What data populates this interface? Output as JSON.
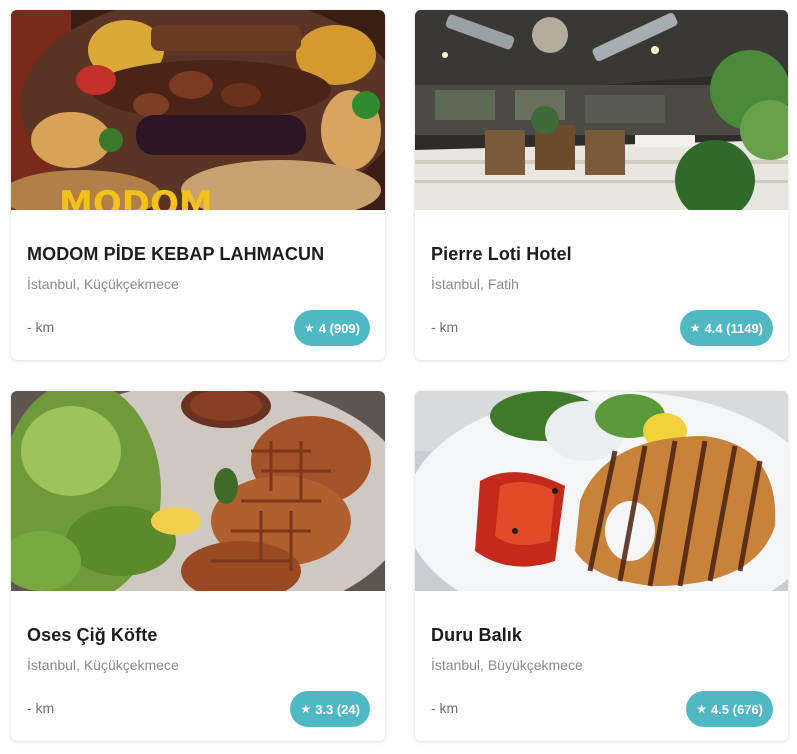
{
  "restaurants": [
    {
      "name": "MODOM PİDE KEBAP LAHMACUN",
      "location": "İstanbul, Küçükçekmece",
      "distance": "- km",
      "rating": "4 (909)",
      "photo_icon": "kebab-platter-photo",
      "photo_caption": "MODOM"
    },
    {
      "name": "Pierre Loti Hotel",
      "location": "İstanbul, Fatih",
      "distance": "- km",
      "rating": "4.4 (1149)",
      "photo_icon": "restaurant-interior-photo"
    },
    {
      "name": "Oses Çiğ Köfte",
      "location": "İstanbul, Küçükçekmece",
      "distance": "- km",
      "rating": "3.3 (24)",
      "photo_icon": "cig-kofte-photo"
    },
    {
      "name": "Duru Balık",
      "location": "İstanbul, Büyükçekmece",
      "distance": "- km",
      "rating": "4.5 (676)",
      "photo_icon": "grilled-fish-photo"
    }
  ],
  "star_glyph": "★",
  "colors": {
    "rating_badge": "#4fb8c3",
    "title_text": "#1d1d1d",
    "location_text": "#8a8a8a"
  }
}
